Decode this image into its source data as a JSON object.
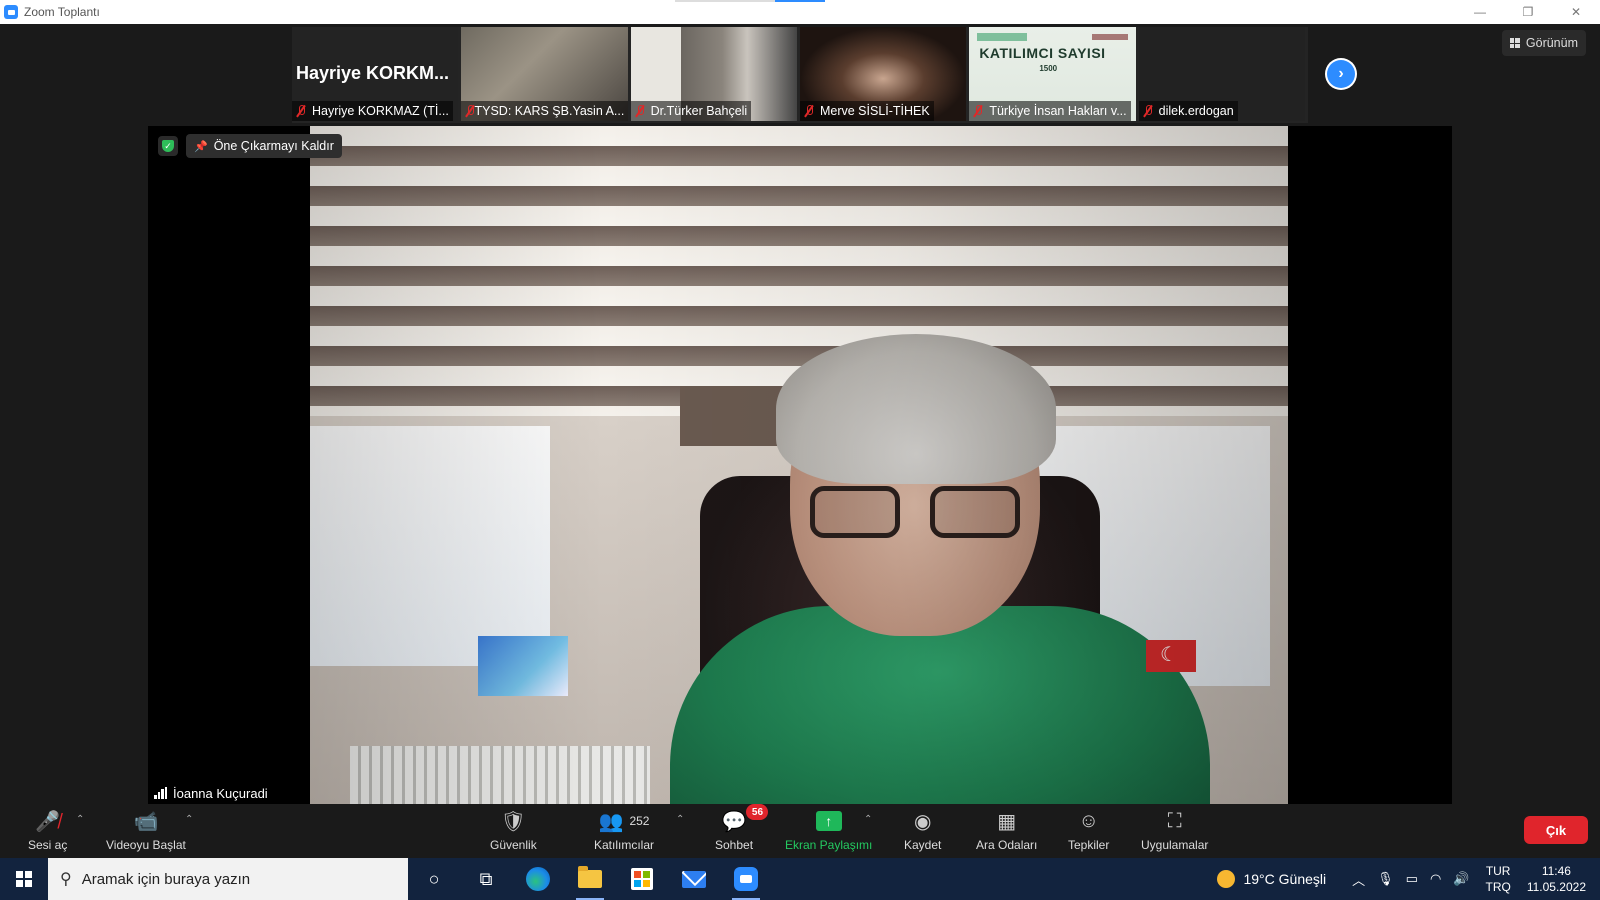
{
  "window": {
    "title": "Zoom Toplantı"
  },
  "gallery": {
    "featured_name": "Hayriye  KORKM...",
    "tiles": [
      {
        "label": "Hayriye KORKMAZ (Tİ..."
      },
      {
        "label": "TYSD: KARS ŞB.Yasin A..."
      },
      {
        "label": "Dr.Türker Bahçeli"
      },
      {
        "label": "Merve SİSLİ-TİHEK"
      },
      {
        "label": "Türkiye İnsan Hakları v...",
        "banner_title": "KATILIMCI SAYISI",
        "banner_number": "1500"
      },
      {
        "label": "dilek.erdogan"
      }
    ],
    "next_icon": "chevron-right-icon"
  },
  "view_button": {
    "label": "Görünüm"
  },
  "main_video": {
    "unpin_label": "Öne Çıkarmayı Kaldır",
    "speaker_name": "İoanna Kuçuradi"
  },
  "toolbar": {
    "unmute": "Sesi aç",
    "start_video": "Videoyu Başlat",
    "security": "Güvenlik",
    "participants": "Katılımcılar",
    "participants_count": "252",
    "chat": "Sohbet",
    "chat_badge": "56",
    "share_screen": "Ekran Paylaşımı",
    "record": "Kaydet",
    "breakout_rooms": "Ara Odaları",
    "reactions": "Tepkiler",
    "apps": "Uygulamalar",
    "leave": "Çık"
  },
  "taskbar": {
    "search_placeholder": "Aramak için buraya yazın",
    "weather": "19°C  Güneşli",
    "lang_top": "TUR",
    "lang_bottom": "TRQ",
    "time": "11:46",
    "date": "11.05.2022"
  },
  "colors": {
    "accent": "#2d8cff",
    "leave": "#e0252c",
    "share": "#1fb85a",
    "taskbar": "#12233e"
  }
}
